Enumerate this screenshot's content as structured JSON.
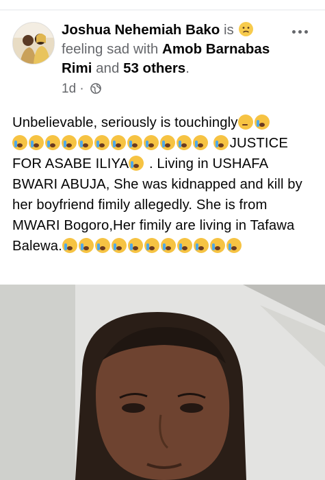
{
  "post": {
    "author": "Joshua Nehemiah Bako",
    "feeling_prefix": "is",
    "feeling_text": "feeling sad with",
    "tagged_person": "Amob Barnabas Rimi",
    "and_text": "and",
    "others_text": "53 others",
    "time": "1d",
    "separator": "·",
    "privacy_icon": "globe-icon",
    "feeling_icon": "sad-face-icon",
    "body_line_1": "Unbelievable, seriously is touchingly",
    "body_line_3_a": "JUSTICE FOR ASABE ILIYA",
    "body_line_3_b": ". Living in USHAFA BWARI ABUJA, She was kidnapped and kill by her boyfriend fimily allegedly. She is from MWARI Bogoro,Her fimily are living in Tafawa Balewa.",
    "photo_description": "Photo of a woman"
  },
  "colors": {
    "text_primary": "#050505",
    "text_secondary": "#65676b",
    "emoji_yellow": "#f6c343"
  }
}
